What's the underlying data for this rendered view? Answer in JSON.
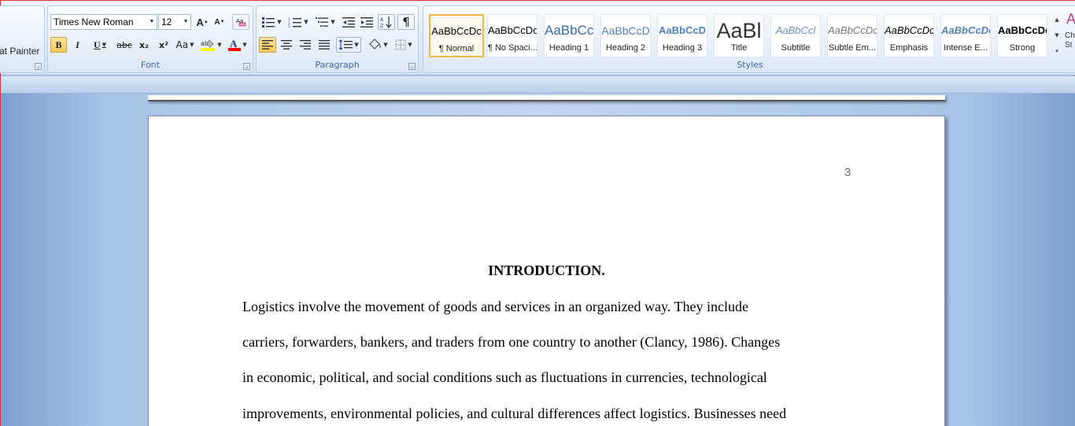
{
  "clipboard": {
    "format_painter_label": "at Painter"
  },
  "font": {
    "group_label": "Font",
    "font_name": "Times New Roman",
    "font_size": "12",
    "bold": "B",
    "italic": "I",
    "underline": "U",
    "strikethrough": "abc",
    "subscript": "x₂",
    "superscript": "x²",
    "change_case": "Aa",
    "grow": "A",
    "shrink": "A"
  },
  "paragraph": {
    "group_label": "Paragraph",
    "pilcrow": "¶"
  },
  "styles": {
    "group_label": "Styles",
    "change_styles_label": "Ch St",
    "items": [
      {
        "sample": "AaBbCcDc",
        "name": "¶ Normal"
      },
      {
        "sample": "AaBbCcDc",
        "name": "¶ No Spaci..."
      },
      {
        "sample": "AaBbCc",
        "name": "Heading 1"
      },
      {
        "sample": "AaBbCcD",
        "name": "Heading 2"
      },
      {
        "sample": "AaBbCcD",
        "name": "Heading 3"
      },
      {
        "sample": "AaBl",
        "name": "Title"
      },
      {
        "sample": "AaBbCcl",
        "name": "Subtitle"
      },
      {
        "sample": "AaBbCcDc",
        "name": "Subtle Em..."
      },
      {
        "sample": "AaBbCcDc",
        "name": "Emphasis"
      },
      {
        "sample": "AaBbCcDc",
        "name": "Intense E..."
      },
      {
        "sample": "AaBbCcDc",
        "name": "Strong"
      }
    ]
  },
  "document": {
    "page_number": "3",
    "heading": "INTRODUCTION.",
    "lines": [
      "Logistics involve the movement of goods and services in an organized way. They include",
      "carriers, forwarders, bankers, and traders from one country to another (Clancy, 1986). Changes",
      "in economic, political, and social conditions such as fluctuations in currencies, technological",
      "improvements, environmental policies, and cultural differences affect logistics. Businesses need"
    ]
  },
  "colors": {
    "highlight": "#ffff00",
    "font_color": "#ff0000",
    "accent_selected": "#f9c85a"
  }
}
